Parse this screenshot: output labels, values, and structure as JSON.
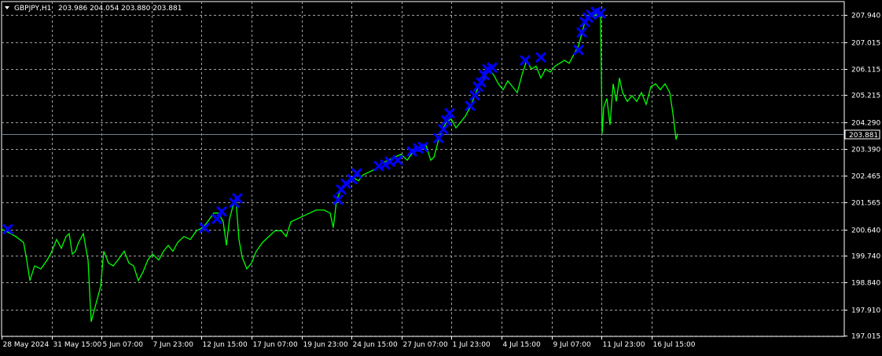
{
  "header": {
    "symbol_label": "GBPJPY,H1",
    "quote_values": "203.986 204.054 203.880 203.881"
  },
  "current_price_label": "203.881",
  "colors": {
    "background": "#000000",
    "grid": "#a0a0a0",
    "price_line": "#00ff00",
    "marker": "#0000ff",
    "axis_text": "#ffffff",
    "current_price_line": "#708090"
  },
  "chart_data": {
    "type": "line",
    "ylim": [
      197.0,
      208.4
    ],
    "current_price": 203.881,
    "y_ticks": [
      "207.940",
      "207.015",
      "206.115",
      "205.215",
      "204.290",
      "203.390",
      "202.465",
      "201.565",
      "200.640",
      "199.740",
      "198.840",
      "197.910",
      "197.015"
    ],
    "x_ticks": [
      "28 May 2024",
      "31 May 15:00",
      "5 Jun 07:00",
      "7 Jun 23:00",
      "12 Jun 15:00",
      "17 Jun 07:00",
      "19 Jun 23:00",
      "24 Jun 15:00",
      "27 Jun 07:00",
      "1 Jul 23:00",
      "4 Jul 15:00",
      "9 Jul 07:00",
      "11 Jul 23:00",
      "16 Jul 15:00"
    ],
    "series": [
      {
        "values": [
          [
            0,
            200.65
          ],
          [
            8,
            200.55
          ],
          [
            18,
            200.4
          ],
          [
            28,
            200.2
          ],
          [
            32,
            199.6
          ],
          [
            36,
            198.9
          ],
          [
            42,
            199.4
          ],
          [
            50,
            199.3
          ],
          [
            58,
            199.6
          ],
          [
            64,
            199.9
          ],
          [
            70,
            200.3
          ],
          [
            76,
            200.0
          ],
          [
            82,
            200.4
          ],
          [
            86,
            200.5
          ],
          [
            90,
            199.8
          ],
          [
            94,
            199.9
          ],
          [
            98,
            200.2
          ],
          [
            104,
            200.5
          ],
          [
            110,
            199.6
          ],
          [
            114,
            197.5
          ],
          [
            118,
            197.9
          ],
          [
            122,
            198.3
          ],
          [
            126,
            198.7
          ],
          [
            130,
            199.9
          ],
          [
            136,
            199.5
          ],
          [
            142,
            199.4
          ],
          [
            148,
            199.6
          ],
          [
            156,
            199.9
          ],
          [
            162,
            199.5
          ],
          [
            168,
            199.4
          ],
          [
            174,
            198.9
          ],
          [
            180,
            199.2
          ],
          [
            186,
            199.6
          ],
          [
            192,
            199.8
          ],
          [
            200,
            199.6
          ],
          [
            206,
            199.9
          ],
          [
            212,
            200.1
          ],
          [
            218,
            199.9
          ],
          [
            224,
            200.2
          ],
          [
            232,
            200.4
          ],
          [
            240,
            200.3
          ],
          [
            248,
            200.6
          ],
          [
            256,
            200.7
          ],
          [
            262,
            200.9
          ],
          [
            270,
            201.2
          ],
          [
            276,
            201.2
          ],
          [
            282,
            200.9
          ],
          [
            286,
            200.1
          ],
          [
            290,
            201.0
          ],
          [
            294,
            201.4
          ],
          [
            298,
            201.7
          ],
          [
            302,
            200.3
          ],
          [
            306,
            199.7
          ],
          [
            312,
            199.3
          ],
          [
            318,
            199.5
          ],
          [
            324,
            199.9
          ],
          [
            332,
            200.2
          ],
          [
            340,
            200.4
          ],
          [
            348,
            200.6
          ],
          [
            356,
            200.6
          ],
          [
            362,
            200.4
          ],
          [
            368,
            200.9
          ],
          [
            376,
            201.0
          ],
          [
            384,
            201.1
          ],
          [
            392,
            201.2
          ],
          [
            400,
            201.3
          ],
          [
            410,
            201.3
          ],
          [
            418,
            201.2
          ],
          [
            422,
            200.7
          ],
          [
            426,
            201.6
          ],
          [
            430,
            201.9
          ],
          [
            436,
            202.1
          ],
          [
            442,
            202.3
          ],
          [
            448,
            202.4
          ],
          [
            454,
            202.3
          ],
          [
            460,
            202.5
          ],
          [
            468,
            202.6
          ],
          [
            476,
            202.7
          ],
          [
            484,
            202.9
          ],
          [
            492,
            203.0
          ],
          [
            500,
            203.1
          ],
          [
            508,
            203.2
          ],
          [
            516,
            203.0
          ],
          [
            524,
            203.3
          ],
          [
            532,
            203.4
          ],
          [
            540,
            203.5
          ],
          [
            546,
            203.0
          ],
          [
            550,
            203.1
          ],
          [
            556,
            203.7
          ],
          [
            560,
            204.0
          ],
          [
            566,
            204.3
          ],
          [
            572,
            204.4
          ],
          [
            578,
            204.1
          ],
          [
            584,
            204.3
          ],
          [
            590,
            204.5
          ],
          [
            596,
            204.8
          ],
          [
            602,
            205.2
          ],
          [
            608,
            205.6
          ],
          [
            614,
            205.8
          ],
          [
            620,
            206.1
          ],
          [
            626,
            205.9
          ],
          [
            632,
            205.6
          ],
          [
            638,
            205.4
          ],
          [
            644,
            205.7
          ],
          [
            650,
            205.5
          ],
          [
            656,
            205.3
          ],
          [
            662,
            205.9
          ],
          [
            668,
            206.4
          ],
          [
            674,
            206.1
          ],
          [
            680,
            206.2
          ],
          [
            686,
            205.8
          ],
          [
            692,
            206.1
          ],
          [
            698,
            206.0
          ],
          [
            704,
            206.2
          ],
          [
            710,
            206.3
          ],
          [
            716,
            206.4
          ],
          [
            722,
            206.3
          ],
          [
            728,
            206.6
          ],
          [
            734,
            206.9
          ],
          [
            738,
            207.3
          ],
          [
            742,
            207.7
          ],
          [
            746,
            207.9
          ],
          [
            750,
            208.0
          ],
          [
            754,
            207.9
          ],
          [
            758,
            208.0
          ],
          [
            762,
            207.85
          ],
          [
            764,
            203.9
          ],
          [
            766,
            204.8
          ],
          [
            770,
            205.1
          ],
          [
            774,
            204.2
          ],
          [
            778,
            205.6
          ],
          [
            782,
            205.0
          ],
          [
            786,
            205.8
          ],
          [
            790,
            205.3
          ],
          [
            796,
            205.0
          ],
          [
            802,
            205.2
          ],
          [
            808,
            205.0
          ],
          [
            814,
            205.3
          ],
          [
            820,
            204.9
          ],
          [
            826,
            205.5
          ],
          [
            832,
            205.6
          ],
          [
            838,
            205.4
          ],
          [
            844,
            205.6
          ],
          [
            850,
            205.3
          ],
          [
            854,
            204.6
          ],
          [
            858,
            203.7
          ],
          [
            860,
            203.9
          ]
        ]
      }
    ],
    "markers": [
      [
        8,
        200.65
      ],
      [
        258,
        200.7
      ],
      [
        274,
        201.0
      ],
      [
        280,
        201.25
      ],
      [
        296,
        201.55
      ],
      [
        300,
        201.7
      ],
      [
        428,
        201.65
      ],
      [
        432,
        202.0
      ],
      [
        438,
        202.2
      ],
      [
        446,
        202.35
      ],
      [
        452,
        202.55
      ],
      [
        480,
        202.8
      ],
      [
        488,
        202.85
      ],
      [
        494,
        202.95
      ],
      [
        504,
        203.0
      ],
      [
        522,
        203.3
      ],
      [
        530,
        203.4
      ],
      [
        536,
        203.45
      ],
      [
        556,
        203.75
      ],
      [
        562,
        204.05
      ],
      [
        566,
        204.35
      ],
      [
        570,
        204.6
      ],
      [
        596,
        204.85
      ],
      [
        602,
        205.2
      ],
      [
        606,
        205.5
      ],
      [
        610,
        205.65
      ],
      [
        614,
        205.9
      ],
      [
        618,
        206.1
      ],
      [
        624,
        206.15
      ],
      [
        666,
        206.4
      ],
      [
        686,
        206.5
      ],
      [
        734,
        206.75
      ],
      [
        738,
        207.35
      ],
      [
        742,
        207.7
      ],
      [
        746,
        207.85
      ],
      [
        750,
        207.95
      ],
      [
        756,
        208.05
      ],
      [
        762,
        208.0
      ]
    ]
  }
}
